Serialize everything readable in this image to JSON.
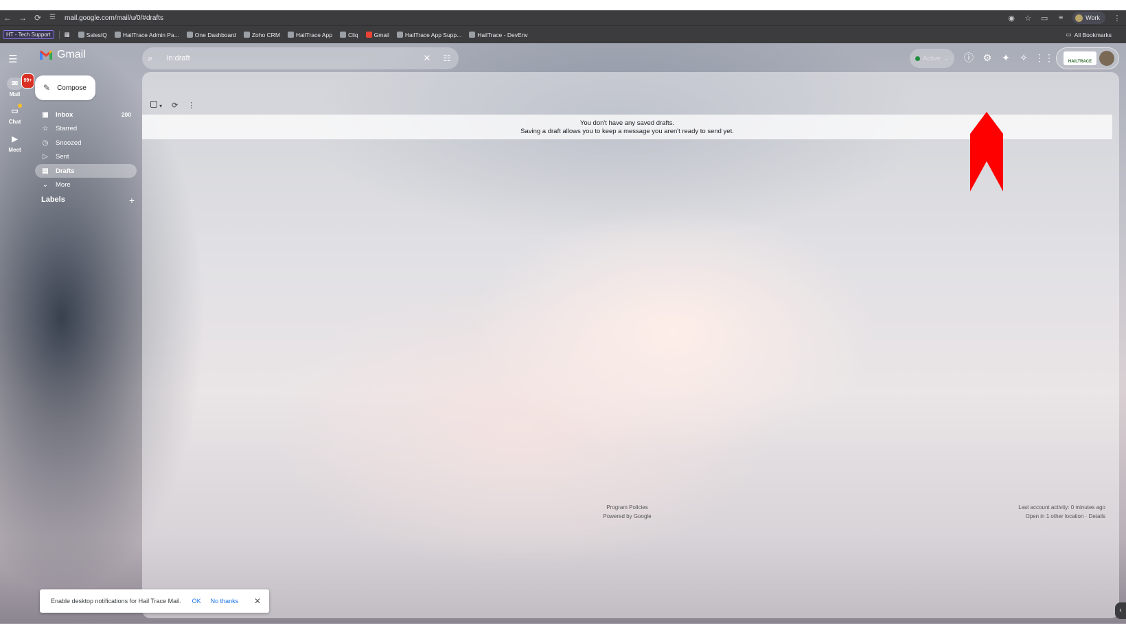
{
  "browser": {
    "url": "mail.google.com/mail/u/0/#drafts",
    "profile": "Work",
    "bookmarks": {
      "tag": "HT - Tech Support",
      "items": [
        "SalesIQ",
        "HailTrace Admin Pa...",
        "One Dashboard",
        "Zoho CRM",
        "HailTrace App",
        "Cliq",
        "Gmail",
        "HailTrace App Supp...",
        "HailTrace - DevEnv"
      ],
      "all": "All Bookmarks"
    }
  },
  "app": {
    "name": "Gmail",
    "rail": {
      "mail": {
        "label": "Mail",
        "badge": "99+"
      },
      "chat": {
        "label": "Chat"
      },
      "meet": {
        "label": "Meet"
      }
    },
    "search": {
      "value": "in:draft"
    },
    "status": "Active",
    "org_logo": "HAILTRACE",
    "compose_label": "Compose",
    "nav": [
      {
        "label": "Inbox",
        "count": "200",
        "icon": "inbox-icon"
      },
      {
        "label": "Starred",
        "icon": "star-icon"
      },
      {
        "label": "Snoozed",
        "icon": "clock-icon"
      },
      {
        "label": "Sent",
        "icon": "send-icon"
      },
      {
        "label": "Drafts",
        "icon": "draft-icon"
      },
      {
        "label": "More",
        "icon": "chevron-down-icon"
      }
    ],
    "labels_title": "Labels",
    "empty": {
      "line1": "You don't have any saved drafts.",
      "line2": "Saving a draft allows you to keep a message you aren't ready to send yet."
    },
    "footer": {
      "policies": "Program Policies",
      "powered": "Powered by Google",
      "activity": "Last account activity: 0 minutes ago",
      "location": "Open in 1 other location · Details"
    },
    "notification": {
      "text": "Enable desktop notifications for Hail Trace Mail.",
      "ok": "OK",
      "no": "No thanks"
    },
    "colors": {
      "accent": "#1a73e8",
      "annotation": "#ff0000"
    }
  }
}
